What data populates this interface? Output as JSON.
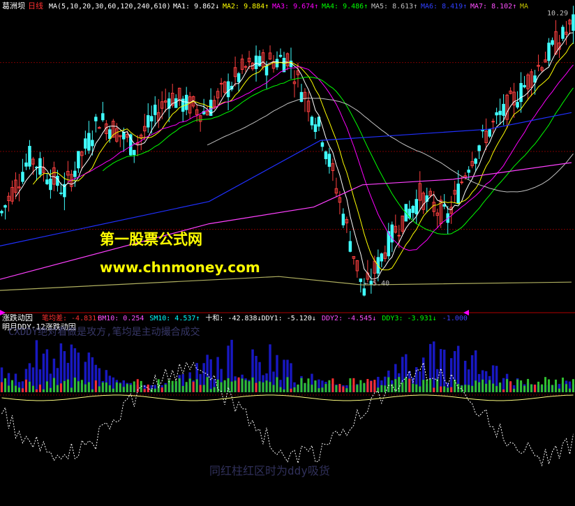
{
  "header": {
    "stock_name": "葛洲坝",
    "period": "日线",
    "ma_params": "MA(5,10,20,30,60,120,240,610)",
    "ma_values": [
      {
        "label": "MA1:",
        "value": "9.862",
        "arrow": "↓",
        "color": "#ffffff"
      },
      {
        "label": "MA2:",
        "value": "9.884",
        "arrow": "↑",
        "color": "#ffff00"
      },
      {
        "label": "MA3:",
        "value": "9.674",
        "arrow": "↑",
        "color": "#ff00ff"
      },
      {
        "label": "MA4:",
        "value": "9.486",
        "arrow": "↑",
        "color": "#00ff00"
      },
      {
        "label": "MA5:",
        "value": "8.613",
        "arrow": "↑",
        "color": "#c0c0c0"
      },
      {
        "label": "MA6:",
        "value": "8.419",
        "arrow": "↑",
        "color": "#3040ff"
      },
      {
        "label": "MA7:",
        "value": "8.102",
        "arrow": "↑",
        "color": "#ff50ff"
      },
      {
        "label": "MA",
        "value": "",
        "arrow": "",
        "color": "#c0c000"
      }
    ],
    "high_label": "10.29",
    "low_label": "5.40"
  },
  "indicator": {
    "panel_title": "涨跌动因",
    "row1": [
      {
        "label": "笔均差:",
        "value": "-4.831",
        "arrow": "↑",
        "color": "#ff3030"
      },
      {
        "label": "BM10:",
        "value": "0.254",
        "arrow": "",
        "color": "#ff50ff"
      },
      {
        "label": "SM10:",
        "value": "4.537",
        "arrow": "↑",
        "color": "#00ffff"
      },
      {
        "label": "十和:",
        "value": "-42.838",
        "arrow": "↓",
        "color": "#ffffff"
      },
      {
        "label": "DDY1:",
        "value": "-5.120",
        "arrow": "↓",
        "color": "#ffffff"
      },
      {
        "label": "DDY2:",
        "value": "-4.545",
        "arrow": "↓",
        "color": "#ff50ff"
      },
      {
        "label": "DDY3:",
        "value": "-3.931",
        "arrow": "↓",
        "color": "#00ff00"
      },
      {
        "label": "",
        "value": "-1.000",
        "arrow": "",
        "color": "#4040ff"
      }
    ],
    "row2": "明月DDY-12涨跌动因",
    "watermark_1": "CXDDY绝对看做是攻方,笔均是主动撮合成交",
    "watermark_2": "同红柱红区时为ddy吸货"
  },
  "brand": {
    "site_name": "第一股票公式网",
    "site_url": "www.chnmoney.com"
  },
  "chart_data": [
    {
      "type": "candlestick",
      "title": "葛洲坝 日线",
      "ylim": [
        5.2,
        10.5
      ],
      "high": 10.29,
      "low": 5.4,
      "series": [
        {
          "name": "MA1",
          "value": 9.862
        },
        {
          "name": "MA2",
          "value": 9.884
        },
        {
          "name": "MA3",
          "value": 9.674
        },
        {
          "name": "MA4",
          "value": 9.486
        },
        {
          "name": "MA5",
          "value": 8.613
        },
        {
          "name": "MA6",
          "value": 8.419
        },
        {
          "name": "MA7",
          "value": 8.102
        }
      ],
      "price_path": [
        {
          "x": 0,
          "y": 6.9
        },
        {
          "x": 8,
          "y": 7.9
        },
        {
          "x": 18,
          "y": 7.3
        },
        {
          "x": 28,
          "y": 8.6
        },
        {
          "x": 38,
          "y": 8.1
        },
        {
          "x": 48,
          "y": 9.0
        },
        {
          "x": 58,
          "y": 8.7
        },
        {
          "x": 70,
          "y": 9.5
        },
        {
          "x": 82,
          "y": 9.7
        },
        {
          "x": 92,
          "y": 8.3
        },
        {
          "x": 104,
          "y": 5.45
        },
        {
          "x": 112,
          "y": 6.5
        },
        {
          "x": 120,
          "y": 7.2
        },
        {
          "x": 128,
          "y": 6.8
        },
        {
          "x": 134,
          "y": 7.8
        },
        {
          "x": 140,
          "y": 8.4
        },
        {
          "x": 148,
          "y": 9.0
        },
        {
          "x": 156,
          "y": 9.7
        },
        {
          "x": 164,
          "y": 10.29
        }
      ],
      "grid": true
    },
    {
      "type": "bar",
      "title": "涨跌动因",
      "ylim": [
        -6,
        6
      ],
      "series": [
        {
          "name": "DDY1",
          "value": -5.12
        },
        {
          "name": "DDY2",
          "value": -4.545
        },
        {
          "name": "DDY3",
          "value": -3.931
        },
        {
          "name": "十和",
          "value": -42.838
        },
        {
          "name": "笔均差",
          "value": -4.831
        },
        {
          "name": "BM10",
          "value": 0.254
        },
        {
          "name": "SM10",
          "value": 4.537
        }
      ],
      "grid": true
    }
  ]
}
